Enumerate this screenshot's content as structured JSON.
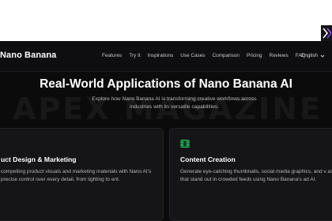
{
  "header": {
    "brand": "Nano Banana",
    "nav_items": [
      "Features",
      "Try It",
      "Inspirations",
      "Use Cases",
      "Comparison",
      "Pricing",
      "Reviews",
      "FAQ"
    ],
    "language": "English"
  },
  "hero": {
    "title": "Real-World Applications of Nano Banana AI",
    "subtitle": "Explore how Nano Banana AI is transforming creative workflows across industries with its versatile capabilities.",
    "watermark": "APEX MAGAZINE"
  },
  "cards": [
    {
      "title": "uct Design & Marketing",
      "text": "compelling product visuals and marketing materials with Nano AI's precise control over every detail, from lighting to ent."
    },
    {
      "title": "Content Creation",
      "text": "Generate eye-catching thumbnails, social media graphics, and v assets that stand out in crowded feeds using Nano Banana's ad AI.",
      "icon": "film-icon",
      "icon_color": "#22c55e"
    }
  ]
}
